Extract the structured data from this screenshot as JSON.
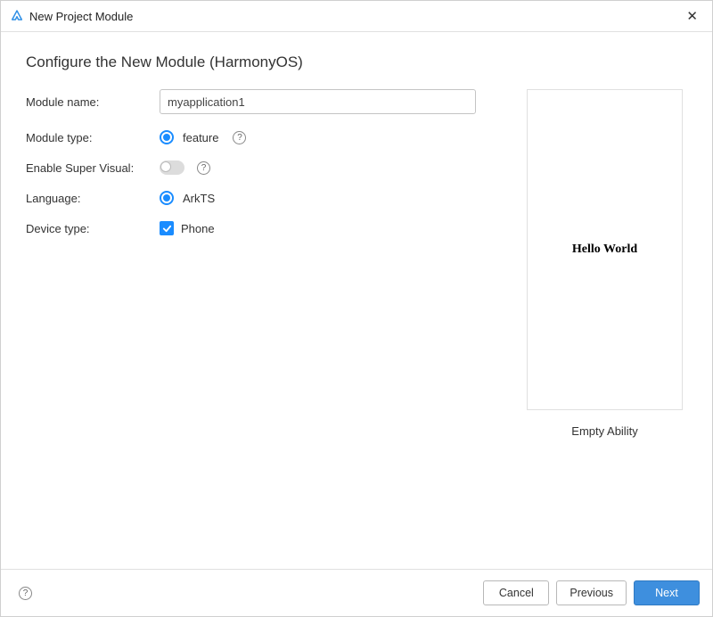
{
  "window": {
    "title": "New Project Module"
  },
  "heading": "Configure the New Module (HarmonyOS)",
  "form": {
    "moduleName": {
      "label": "Module name:",
      "value": "myapplication1"
    },
    "moduleType": {
      "label": "Module type:",
      "option": "feature"
    },
    "enableSuperVisual": {
      "label": "Enable Super Visual:"
    },
    "language": {
      "label": "Language:",
      "option": "ArkTS"
    },
    "deviceType": {
      "label": "Device type:",
      "option": "Phone"
    }
  },
  "preview": {
    "text": "Hello World",
    "caption": "Empty Ability"
  },
  "footer": {
    "cancel": "Cancel",
    "previous": "Previous",
    "next": "Next"
  }
}
